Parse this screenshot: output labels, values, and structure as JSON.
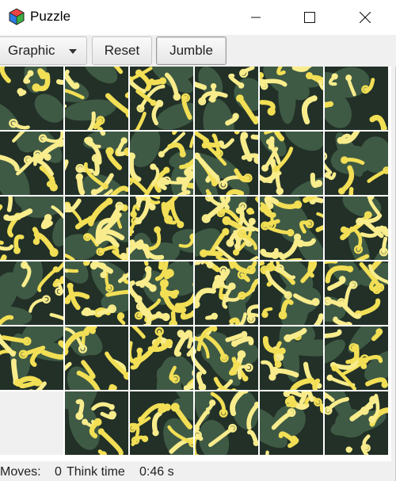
{
  "window": {
    "title": "Puzzle",
    "icon": "puzzle-cube-icon"
  },
  "toolbar": {
    "graphic_label": "Graphic",
    "reset_label": "Reset",
    "jumble_label": "Jumble"
  },
  "board": {
    "rows": 6,
    "cols": 6,
    "blank_tile": {
      "row": 5,
      "col": 0
    }
  },
  "status": {
    "moves_label": "Moves:",
    "moves_value": "0",
    "think_label": "Think time",
    "think_value": "0:46 s"
  },
  "colors": {
    "petal": "#f2df55",
    "petal_light": "#f8ec8c",
    "leaf": "#3f5a44",
    "leaf_dark": "#223027",
    "background": "#f0f0f0"
  }
}
